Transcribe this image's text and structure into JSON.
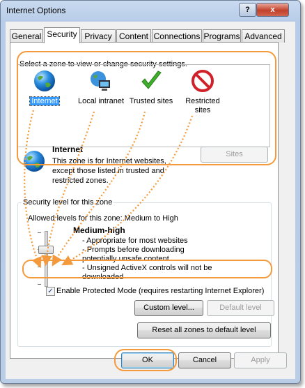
{
  "window": {
    "title": "Internet Options",
    "help_label": "?",
    "close_label": "x"
  },
  "tabs": [
    "General",
    "Security",
    "Privacy",
    "Content",
    "Connections",
    "Programs",
    "Advanced"
  ],
  "security": {
    "select_zone_text": "Select a zone to view or change security settings.",
    "zones": [
      {
        "label": "Internet",
        "icon": "globe-icon"
      },
      {
        "label": "Local intranet",
        "icon": "intranet-icon"
      },
      {
        "label": "Trusted sites",
        "icon": "checkmark-icon"
      },
      {
        "label": "Restricted sites",
        "icon": "restricted-icon"
      }
    ],
    "zone_title": "Internet",
    "zone_description": "This zone is for Internet websites, except those listed in trusted and restricted zones.",
    "sites_button": "Sites",
    "level_group_title": "Security level for this zone",
    "allowed_levels": "Allowed levels for this zone: Medium to High",
    "level_name": "Medium-high",
    "level_points": [
      "- Appropriate for most websites",
      "- Prompts before downloading potentially unsafe content",
      "- Unsigned ActiveX controls will not be downloaded"
    ],
    "protected_mode_label": "Enable Protected Mode (requires restarting Internet Explorer)",
    "protected_mode_checked": true,
    "custom_level_button": "Custom level...",
    "default_level_button": "Default level",
    "reset_all_button": "Reset all zones to default level"
  },
  "footer": {
    "ok": "OK",
    "cancel": "Cancel",
    "apply": "Apply"
  },
  "colors": {
    "highlight": "#f49a3c",
    "selection": "#3399ff"
  }
}
